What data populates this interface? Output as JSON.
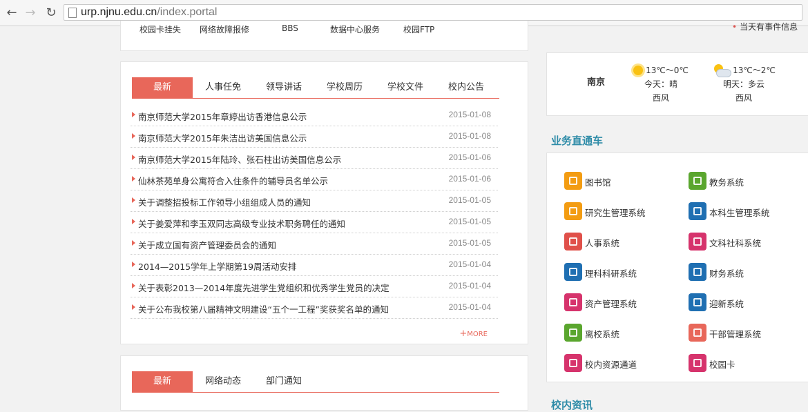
{
  "browser": {
    "url_host": "urp.njnu.edu.cn",
    "url_path": "/index.portal"
  },
  "top_links": [
    "校园卡挂失",
    "网络故障报修",
    "BBS",
    "数据中心服务",
    "校园FTP"
  ],
  "top_notice": "当天有事件信息",
  "news_panel": {
    "tabs": [
      "最新",
      "人事任免",
      "领导讲话",
      "学校周历",
      "学校文件",
      "校内公告"
    ],
    "active_tab": "最新",
    "items": [
      {
        "title": "南京师范大学2015年章婷出访香港信息公示",
        "date": "2015-01-08"
      },
      {
        "title": "南京师范大学2015年朱洁出访美国信息公示",
        "date": "2015-01-08"
      },
      {
        "title": "南京师范大学2015年陆玲、张石柱出访美国信息公示",
        "date": "2015-01-06"
      },
      {
        "title": "仙林茶苑单身公寓符合入住条件的辅导员名单公示",
        "date": "2015-01-06"
      },
      {
        "title": "关于调整招投标工作领导小组组成人员的通知",
        "date": "2015-01-05"
      },
      {
        "title": "关于姜爱萍和李玉双同志高级专业技术职务聘任的通知",
        "date": "2015-01-05"
      },
      {
        "title": "关于成立国有资产管理委员会的通知",
        "date": "2015-01-05"
      },
      {
        "title": "2014—2015学年上学期第19周活动安排",
        "date": "2015-01-04"
      },
      {
        "title": "关于表彰2013—2014年度先进学生党组织和优秀学生党员的决定",
        "date": "2015-01-04"
      },
      {
        "title": "关于公布我校第八届精神文明建设“五个一工程”奖获奖名单的通知",
        "date": "2015-01-04"
      }
    ],
    "more_plus": "+",
    "more_label": "MORE"
  },
  "second_panel": {
    "tabs": [
      "最新",
      "网络动态",
      "部门通知"
    ],
    "active_tab": "最新"
  },
  "weather": {
    "city": "南京",
    "today": {
      "temp": "13℃～0℃",
      "desc": "今天：晴",
      "wind": "西风",
      "icon": "sun-icon"
    },
    "tomorrow": {
      "temp": "13℃～2℃",
      "desc": "明天：多云",
      "wind": "西风",
      "icon": "partly-cloudy-icon"
    }
  },
  "services_title": "业务直通车",
  "services": [
    {
      "label": "图书馆",
      "color": "#f39c12",
      "icon": "library-icon"
    },
    {
      "label": "教务系统",
      "color": "#5aa62e",
      "icon": "chart-icon"
    },
    {
      "label": "研究生管理系统",
      "color": "#f39c12",
      "icon": "graduate-icon"
    },
    {
      "label": "本科生管理系统",
      "color": "#1f6fb2",
      "icon": "student-icon"
    },
    {
      "label": "人事系统",
      "color": "#e0504a",
      "icon": "personnel-icon"
    },
    {
      "label": "文科社科系统",
      "color": "#d6336c",
      "icon": "monitor-icon"
    },
    {
      "label": "理科科研系统",
      "color": "#1f6fb2",
      "icon": "screen-icon"
    },
    {
      "label": "财务系统",
      "color": "#1f6fb2",
      "icon": "calculator-icon"
    },
    {
      "label": "资产管理系统",
      "color": "#d6336c",
      "icon": "asset-icon"
    },
    {
      "label": "迎新系统",
      "color": "#1f6fb2",
      "icon": "welcome-icon"
    },
    {
      "label": "离校系统",
      "color": "#5aa62e",
      "icon": "leave-icon"
    },
    {
      "label": "干部管理系统",
      "color": "#e8675a",
      "icon": "cadre-icon"
    },
    {
      "label": "校内资源通道",
      "color": "#d6336c",
      "icon": "globe-icon"
    },
    {
      "label": "校园卡",
      "color": "#d6336c",
      "icon": "card-icon"
    }
  ],
  "bottom_section_title": "校内资讯"
}
